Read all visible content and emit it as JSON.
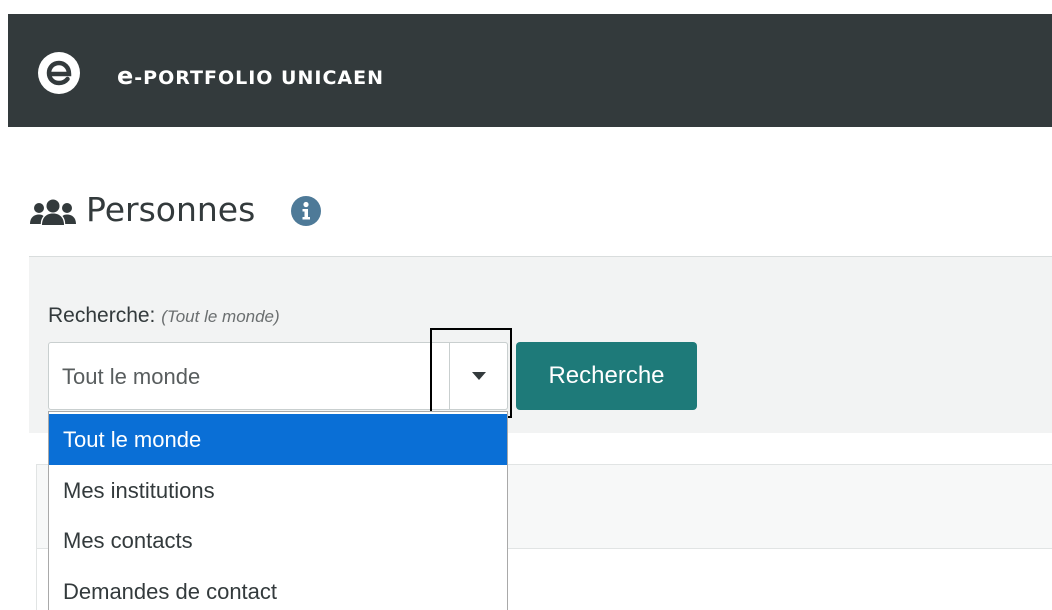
{
  "header": {
    "brand_prefix": "e",
    "brand_text": "-PORTFOLIO UNICAEN",
    "background": "#333a3c",
    "logo_icon": "eportfolio-logo-icon"
  },
  "page": {
    "title": "Personnes",
    "title_icon": "people-group-icon",
    "info_icon": "info-icon"
  },
  "search": {
    "label": "Recherche:",
    "current_filter": "(Tout le monde)",
    "select_value": "Tout le monde",
    "button_label": "Recherche",
    "button_color": "#1e7a79"
  },
  "dropdown": {
    "selected_color": "#0a6fd6",
    "options": [
      {
        "label": "Tout le monde",
        "selected": true
      },
      {
        "label": "Mes institutions",
        "selected": false
      },
      {
        "label": "Mes contacts",
        "selected": false
      },
      {
        "label": "Demandes de contact",
        "selected": false
      }
    ]
  }
}
